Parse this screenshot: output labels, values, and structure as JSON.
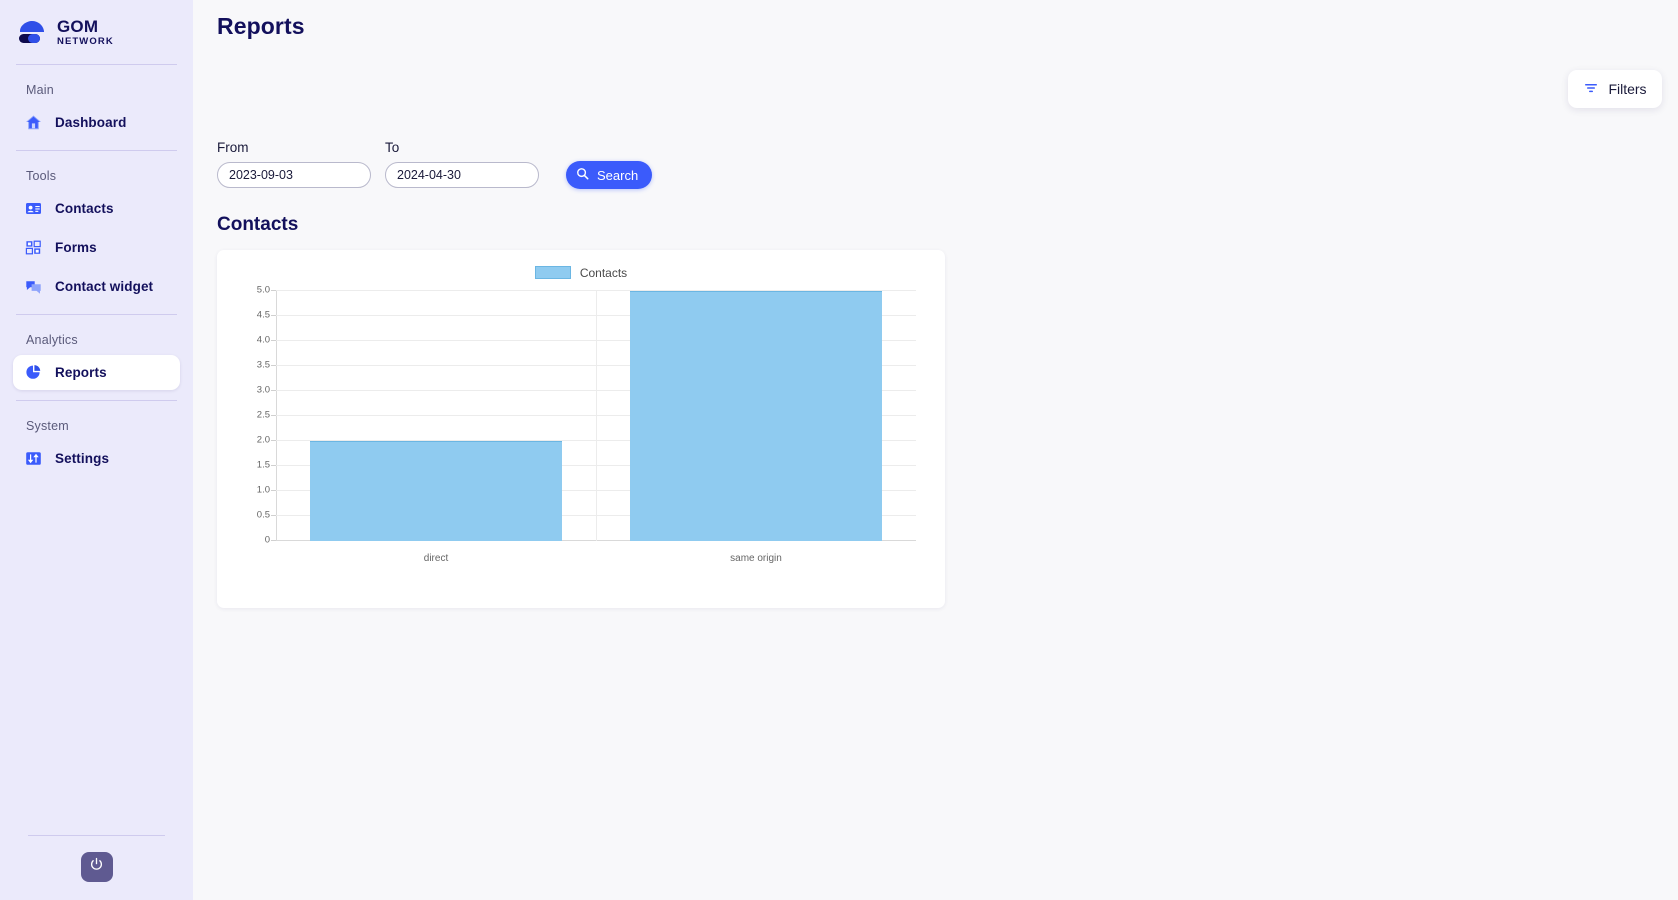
{
  "brand": {
    "name": "GOM",
    "sub": "NETWORK",
    "logo_icon": "cloud-logo-icon"
  },
  "sidebar": {
    "groups": [
      {
        "label": "Main",
        "items": [
          {
            "label": "Dashboard",
            "icon": "home-icon",
            "active": false
          }
        ]
      },
      {
        "label": "Tools",
        "items": [
          {
            "label": "Contacts",
            "icon": "contact-card-icon",
            "active": false
          },
          {
            "label": "Forms",
            "icon": "forms-grid-icon",
            "active": false
          },
          {
            "label": "Contact widget",
            "icon": "chat-bubbles-icon",
            "active": false
          }
        ]
      },
      {
        "label": "Analytics",
        "items": [
          {
            "label": "Reports",
            "icon": "pie-chart-icon",
            "active": true
          }
        ]
      },
      {
        "label": "System",
        "items": [
          {
            "label": "Settings",
            "icon": "sliders-icon",
            "active": false
          }
        ]
      }
    ],
    "power_icon": "power-icon"
  },
  "header": {
    "title": "Reports"
  },
  "filters_button": {
    "label": "Filters",
    "icon": "filter-icon"
  },
  "search_form": {
    "from_label": "From",
    "from_value": "2023-09-03",
    "from_placeholder": "YYYY-MM-DD",
    "to_label": "To",
    "to_value": "2024-04-30",
    "to_placeholder": "YYYY-MM-DD",
    "search_label": "Search",
    "search_icon": "search-icon"
  },
  "section": {
    "title": "Contacts"
  },
  "colors": {
    "accent": "#3b5bfb",
    "brand_navy": "#13105c",
    "sidebar_bg": "#ebeafb",
    "bar_fill": "#8fcbf0",
    "bar_stroke": "#6bb6e3",
    "power_btn": "#5f5a91"
  },
  "chart_data": {
    "type": "bar",
    "title": "Contacts",
    "categories": [
      "direct",
      "same origin"
    ],
    "values": [
      2,
      5
    ],
    "series": [
      {
        "name": "Contacts",
        "values": [
          2,
          5
        ]
      }
    ],
    "legend": [
      "Contacts"
    ],
    "legend_position": "top-center",
    "xlabel": "",
    "ylabel": "",
    "ylim": [
      0,
      5
    ],
    "yticks": [
      "0",
      "0.5",
      "1.0",
      "1.5",
      "2.0",
      "2.5",
      "3.0",
      "3.5",
      "4.0",
      "4.5",
      "5.0"
    ],
    "ytick_values": [
      0,
      0.5,
      1,
      1.5,
      2,
      2.5,
      3,
      3.5,
      4,
      4.5,
      5
    ],
    "grid": true
  }
}
